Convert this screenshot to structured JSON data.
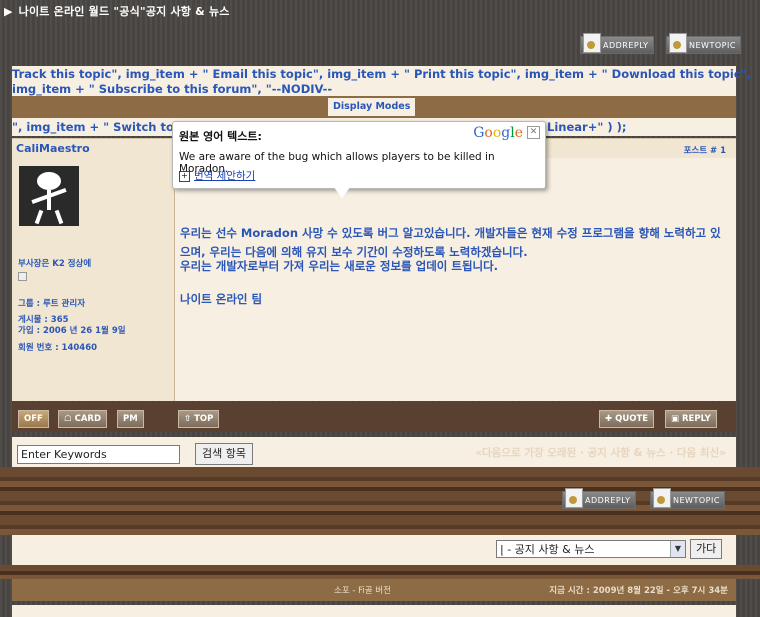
{
  "header": {
    "forum_title": "나이트 온라인 월드 \"공식\"공지 사항 & 뉴스",
    "addreply": "ADDREPLY",
    "newtopic": "NEWTOPIC"
  },
  "topic_links": {
    "line1": "Track this topic\", img_item + \" Email this topic\", img_item + \" Print this topic\", img_item + \" Download this topic\",",
    "line2": "img_item + \" Subscribe to this forum\", \"--NODIV--",
    "display_modes": "Display Modes",
    "switch_row_left": "\", img_item + \" Switch to",
    "switch_row_right": "Linear+\" ) );"
  },
  "post": {
    "author": "CaliMaestro",
    "post_number": "포스트 # 1",
    "rank": "부사장은 K2 정상에",
    "group": "그룹 : 루트 관리자",
    "posts": "게시물 : 365",
    "joined": "가입 : 2006 년 26 1월 9일",
    "member_no": "회원 번호 : 140460",
    "paragraph1": "우리는 선수 Moradon 사망 수 있도록 버그 알고있습니다. 개발자들은 현재 수정 프로그램을 향해 노력하고 있으며, 우리는 다음에 의해 유지 보수 기간이 수정하도록 노력하겠습니다.",
    "paragraph2": "우리는 개발자로부터 가져 우리는 새로운 정보를 업데이 트됩니다.",
    "signature": "나이트 온라인 팀"
  },
  "actions": {
    "off": "OFF",
    "card": "CARD",
    "pm": "PM",
    "top": "TOP",
    "quote": "QUOTE",
    "reply": "REPLY"
  },
  "search": {
    "keywords_value": "Enter Keywords",
    "search_button": "검색 항목",
    "nav_links": "«다음으로 가장 오래된 · 공지 사항 & 뉴스 · 다음 최신»"
  },
  "bottom": {
    "addreply": "ADDREPLY",
    "newtopic": "NEWTOPIC",
    "jump_select": "| - 공지 사항 & 뉴스",
    "go_button": "가다",
    "lofi": "소포 - Fi골 버전",
    "time": "지금 시간 : 2009년 8월 22일 - 오후 7시 34분"
  },
  "translate_popup": {
    "title": "원본 영어 텍스트:",
    "brand": "Google",
    "original_text": "We are aware of the bug which allows players to be killed in Moradon.",
    "suggest": "번역 제안하기"
  }
}
